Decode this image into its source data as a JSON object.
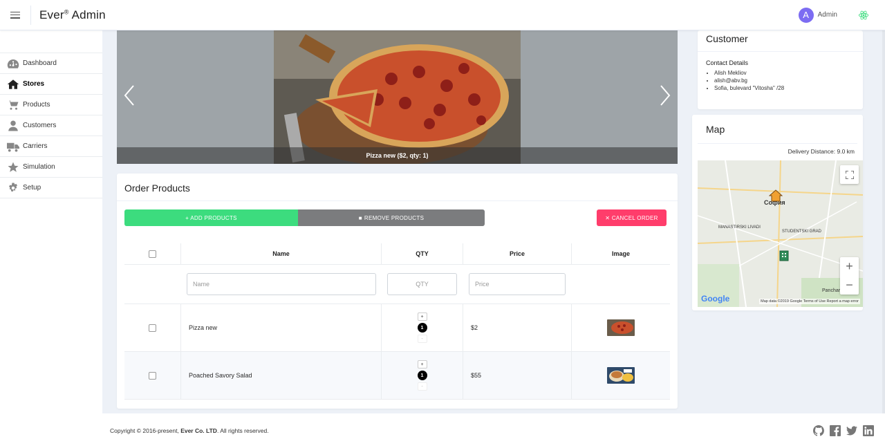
{
  "header": {
    "brand": "Ever",
    "brand_mark": "®",
    "brand_suffix": " Admin",
    "user_initial": "A",
    "user_name": "Admin",
    "menu_icon": "hamburger-icon",
    "theme_icon": "react-icon"
  },
  "sidebar": {
    "items": [
      {
        "label": "Dashboard",
        "icon": "dashboard-icon",
        "active": false
      },
      {
        "label": "Stores",
        "icon": "home-icon",
        "active": true
      },
      {
        "label": "Products",
        "icon": "cart-icon",
        "active": false
      },
      {
        "label": "Customers",
        "icon": "user-icon",
        "active": false
      },
      {
        "label": "Carriers",
        "icon": "truck-icon",
        "active": false
      },
      {
        "label": "Simulation",
        "icon": "star-icon",
        "active": false
      },
      {
        "label": "Setup",
        "icon": "gear-icon",
        "active": false
      }
    ]
  },
  "carousel": {
    "caption": "Pizza new ($2, qty: 1)"
  },
  "order_products": {
    "title": "Order Products",
    "add_label": "+ ADD PRODUCTS",
    "remove_label": "REMOVE PRODUCTS",
    "cancel_label": "✕ CANCEL ORDER",
    "columns": [
      "Name",
      "QTY",
      "Price",
      "Image"
    ],
    "filters": {
      "name": "Name",
      "qty": "QTY",
      "price": "Price"
    },
    "rows": [
      {
        "name": "Pizza new",
        "qty": "1",
        "price": "$2",
        "plus": "+",
        "minus": "-"
      },
      {
        "name": "Poached Savory Salad",
        "qty": "1",
        "price": "$55",
        "plus": "+",
        "minus": "-"
      }
    ]
  },
  "customer": {
    "title": "Customer",
    "contact_title": "Contact Details",
    "contacts": [
      "Alish Mekliov",
      "alish@abv.bg",
      "Sofia, bulevard \"Vitosha\" /28"
    ]
  },
  "map": {
    "title": "Map",
    "delivery": "Delivery Distance: 9.0 km",
    "google": "Google",
    "footer": "Map data ©2019 Google   Terms of Use   Report a map error",
    "labels": {
      "city": "София",
      "district1": "MANASTIRSKI LIVADI",
      "district2": "STUDENTSKI GRAD",
      "district3": "Pancharevo"
    }
  },
  "footer": {
    "copyright_prefix": "Copyright © 2016-present, ",
    "company": "Ever Co. LTD",
    "copyright_suffix": ". All rights reserved."
  },
  "colors": {
    "add": "#3cdc7e",
    "remove": "#7b7c7e",
    "cancel": "#ff3d6b",
    "avatar": "#7c6cf2"
  }
}
